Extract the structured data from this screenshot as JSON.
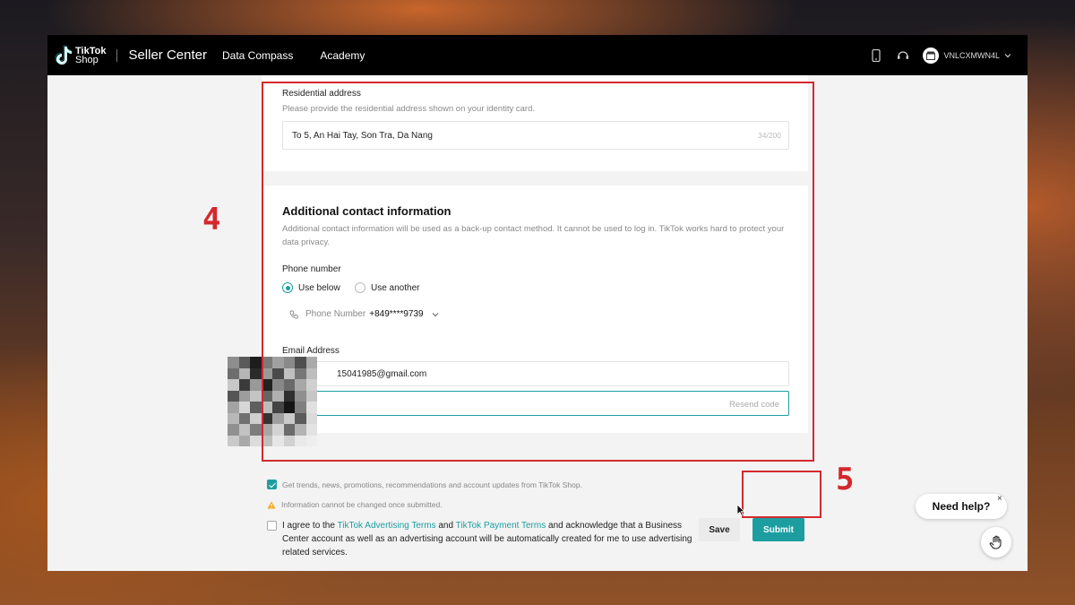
{
  "topbar": {
    "logo_line1": "TikTok",
    "logo_line2": "Shop",
    "app_title": "Seller Center",
    "nav": [
      "Data Compass",
      "Academy"
    ],
    "account_name": "VNLCXMWN4L"
  },
  "residential": {
    "label": "Residential address",
    "hint": "Please provide the residential address shown on your identity card.",
    "value": "To 5, An Hai Tay, Son Tra, Da Nang",
    "counter": "34/200"
  },
  "contact": {
    "title": "Additional contact information",
    "description": "Additional contact information will be used as a back-up contact method. It cannot be used to log in. TikTok works hard to protect your data privacy.",
    "phone_label": "Phone number",
    "radio_use_below": "Use below",
    "radio_use_another": "Use another",
    "phone_placeholder": "Phone Number",
    "phone_value": "+849****9739",
    "email_label": "Email Address",
    "email_value": "15041985@gmail.com",
    "resend_code": "Resend code",
    "marketing_consent": "Get trends, news, promotions, recommendations and account updates from TikTok Shop."
  },
  "footer": {
    "warning": "Information cannot be changed once submitted.",
    "agree_prefix": "I agree to the ",
    "advertising_terms": "TikTok Advertising Terms",
    "agree_and": " and ",
    "payment_terms": "TikTok Payment Terms",
    "agree_suffix": " and acknowledge that a Business Center account as well as an advertising account will be automatically created for me to use advertising related services.",
    "save_label": "Save",
    "submit_label": "Submit"
  },
  "annotations": {
    "step4": "4",
    "step5": "5",
    "color": "#d22a2e"
  },
  "help": {
    "label": "Need help?",
    "close": "×"
  },
  "colors": {
    "accent": "#1c9ea0",
    "topbar": "#000000"
  }
}
